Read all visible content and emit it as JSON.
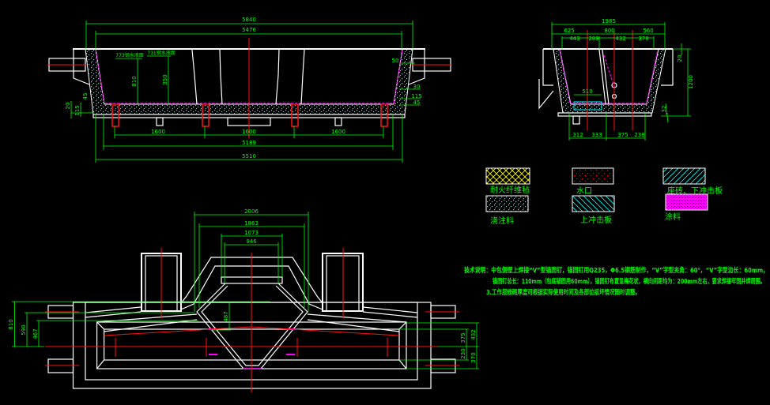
{
  "elevation_view": {
    "dims": {
      "overall_top": "5840",
      "inner_top": "5476",
      "bottom_overall": "5510",
      "bottom_inner": "5189",
      "spacing_1": "1600",
      "spacing_2": "1600",
      "spacing_3": "1600",
      "height_810": "810",
      "height_350": "350",
      "d45": "45",
      "d20": "20",
      "d115": "115",
      "r50": "50",
      "r30": "30",
      "r115": "115",
      "r45": "45"
    },
    "level_labels": [
      "773钢水液面",
      "731钢水液面"
    ]
  },
  "side_view": {
    "dims": {
      "overall": "1985",
      "top_a": "625",
      "top_b": "800",
      "top_c": "560",
      "mid_a": "443",
      "mid_b": "289",
      "mid_c": "432",
      "mid_d": "378",
      "block": "510",
      "bot_a": "312",
      "bot_b": "333",
      "bot_c": "375",
      "bot_d": "238",
      "height": "1200",
      "top_offset": "20",
      "bottom_offset": "32"
    }
  },
  "plan_view": {
    "dims": {
      "w2006": "2006",
      "w1863": "1863",
      "w1073": "1073",
      "w946": "946",
      "h810": "810",
      "h590": "590",
      "h467": "467",
      "h487": "487",
      "r432": "432",
      "r375": "375",
      "r230": "230",
      "r370": "370"
    }
  },
  "legend": [
    {
      "label": "耐火纤维毡",
      "pattern": "crosshatch",
      "color": "#ffff00"
    },
    {
      "label": "水口",
      "pattern": "dots",
      "color": "#ff0000"
    },
    {
      "label": "座砖、下冲击板",
      "pattern": "diagonal",
      "color": "#00ffff"
    },
    {
      "label": "浇注料",
      "pattern": "dots",
      "color": "#00ffff"
    },
    {
      "label": "上冲击板",
      "pattern": "diagonal",
      "color": "#00ffff"
    },
    {
      "label": "涂料",
      "pattern": "dense",
      "color": "#ff00ff"
    }
  ],
  "notes": {
    "line1": "技术说明：中包侧壁上焊接“V”型锚固钉，锚固钉用Q235，Φ6.5钢筋制作，“V”字型夹角：60°，“V”字型边长：60mm，",
    "line2": "锚固钉总长：110mm（包底锚固用60mm），锚固钉布置呈梅花状，横向间距均为：200mm左右，要求焊接牢固并焊周围。",
    "line3": "3.工作层修砌厚度可根据实际使用时间及各部位损坏情况随时调整。"
  },
  "colors": {
    "background": "#000000",
    "outline": "#ffffff",
    "dimension": "#00ff00",
    "centerline": "#ff0000",
    "castable": "#00ffff",
    "coating": "#ff00ff",
    "fiber": "#ffff00"
  }
}
